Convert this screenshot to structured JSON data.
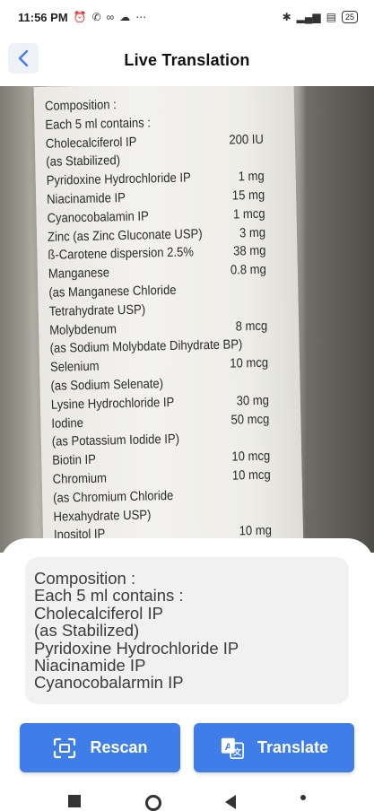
{
  "status_bar": {
    "time": "11:56 PM",
    "battery": "25"
  },
  "header": {
    "title": "Live Translation"
  },
  "camera_label": {
    "rows": [
      {
        "text": "Composition :",
        "value": ""
      },
      {
        "text": "Each 5 ml contains :",
        "value": ""
      },
      {
        "text": "Cholecalciferol IP",
        "value": "200 IU"
      },
      {
        "text": "(as Stabilized)",
        "value": ""
      },
      {
        "text": "Pyridoxine Hydrochloride IP",
        "value": "1 mg"
      },
      {
        "text": "Niacinamide IP",
        "value": "15 mg"
      },
      {
        "text": "Cyanocobalamin IP",
        "value": "1 mcg"
      },
      {
        "text": "Zinc (as Zinc Gluconate USP)",
        "value": "3 mg"
      },
      {
        "text": "ß-Carotene dispersion 2.5%",
        "value": "38 mg"
      },
      {
        "text": "Manganese",
        "value": "0.8 mg"
      },
      {
        "text": "(as Manganese Chloride",
        "value": ""
      },
      {
        "text": "Tetrahydrate USP)",
        "value": ""
      },
      {
        "text": "Molybdenum",
        "value": "8 mcg"
      },
      {
        "text": "(as Sodium Molybdate Dihydrate BP)",
        "value": ""
      },
      {
        "text": "Selenium",
        "value": "10 mcg"
      },
      {
        "text": "(as Sodium Selenate)",
        "value": ""
      },
      {
        "text": "Lysine Hydrochloride IP",
        "value": "30 mg"
      },
      {
        "text": "Iodine",
        "value": "50 mcg"
      },
      {
        "text": "(as Potassium Iodide IP)",
        "value": ""
      },
      {
        "text": "Biotin IP",
        "value": "10 mcg"
      },
      {
        "text": "Chromium",
        "value": "10 mcg"
      },
      {
        "text": "(as Chromium Chloride",
        "value": ""
      },
      {
        "text": "Hexahydrate USP)",
        "value": ""
      },
      {
        "text": "Inositol IP",
        "value": "10 mg"
      }
    ]
  },
  "result": {
    "lines": [
      "Composition :",
      "Each 5 ml contains :",
      "Cholecalciferol IP",
      "(as Stabilized)",
      "Pyridoxine Hydrochloride IP",
      "Niacinamide IP",
      "Cyanocobalarmin IP"
    ]
  },
  "buttons": {
    "rescan_label": "Rescan",
    "translate_label": "Translate"
  },
  "icons": {
    "back": "chevron-left-icon",
    "rescan": "scan-frame-icon",
    "translate": "translate-icon"
  },
  "colors": {
    "accent": "#3f7de8",
    "back_bg": "#eef1f6",
    "result_bg": "#f1f1f1"
  }
}
